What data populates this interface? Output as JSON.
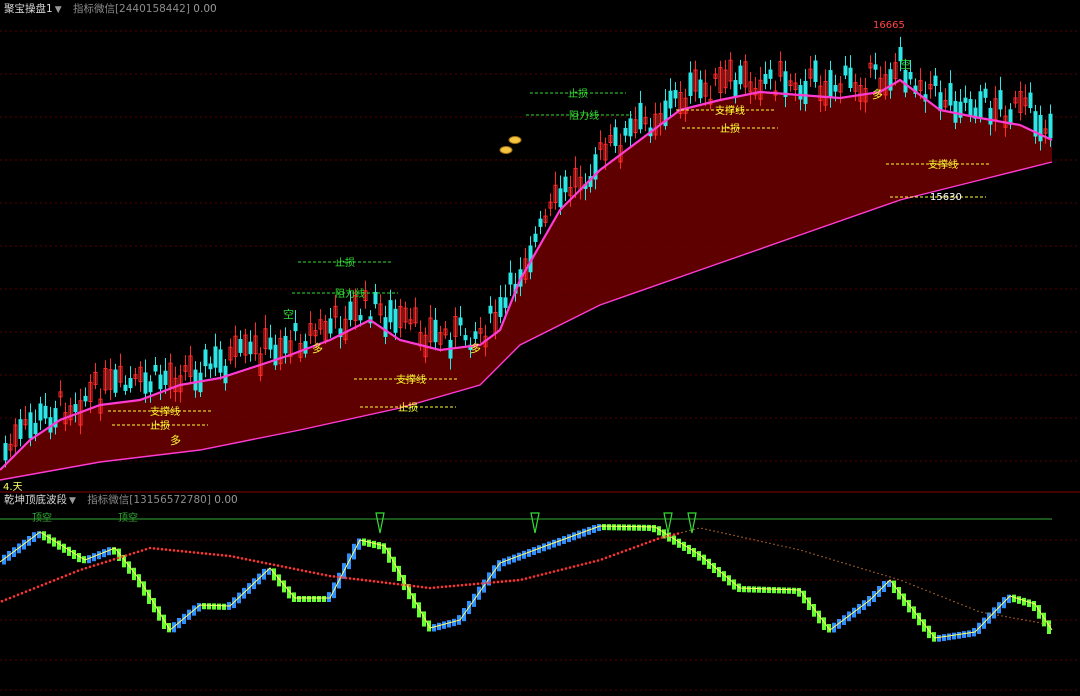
{
  "main_panel": {
    "indicator_name": "聚宝操盘1",
    "indicator_info": "指标微信[2440158442]",
    "indicator_value": "0.00",
    "high_label": "16665",
    "low_label": "15630",
    "corner_label": "4.天"
  },
  "sub_panel": {
    "indicator_name": "乾坤顶底波段",
    "indicator_info": "指标微信[13156572780]",
    "indicator_value": "0.00",
    "signal_label": "顶空"
  },
  "annotations": {
    "stop_loss": "止损",
    "resistance": "阻力线",
    "support": "支撑线",
    "long": "多",
    "short": "空"
  },
  "colors": {
    "background": "#000000",
    "grid": "#5a0000",
    "fill": "#6e0000",
    "ma_fast": "#ff3bd4",
    "ma_slow": "#ff3bd4",
    "up_candle": "#ff2a2a",
    "down_candle": "#2ee6e6",
    "wave_rise": "#2f8fff",
    "wave_fall": "#66ff33",
    "wave_line": "#ffff66",
    "trend_dots": "#ff3333",
    "annotation_yellow": "#ffff33",
    "annotation_green": "#33dd33",
    "signal_line": "#33aa33"
  },
  "icons": [
    "gold-ingot-icon",
    "down-arrow-signal-icon",
    "star-icon"
  ]
}
